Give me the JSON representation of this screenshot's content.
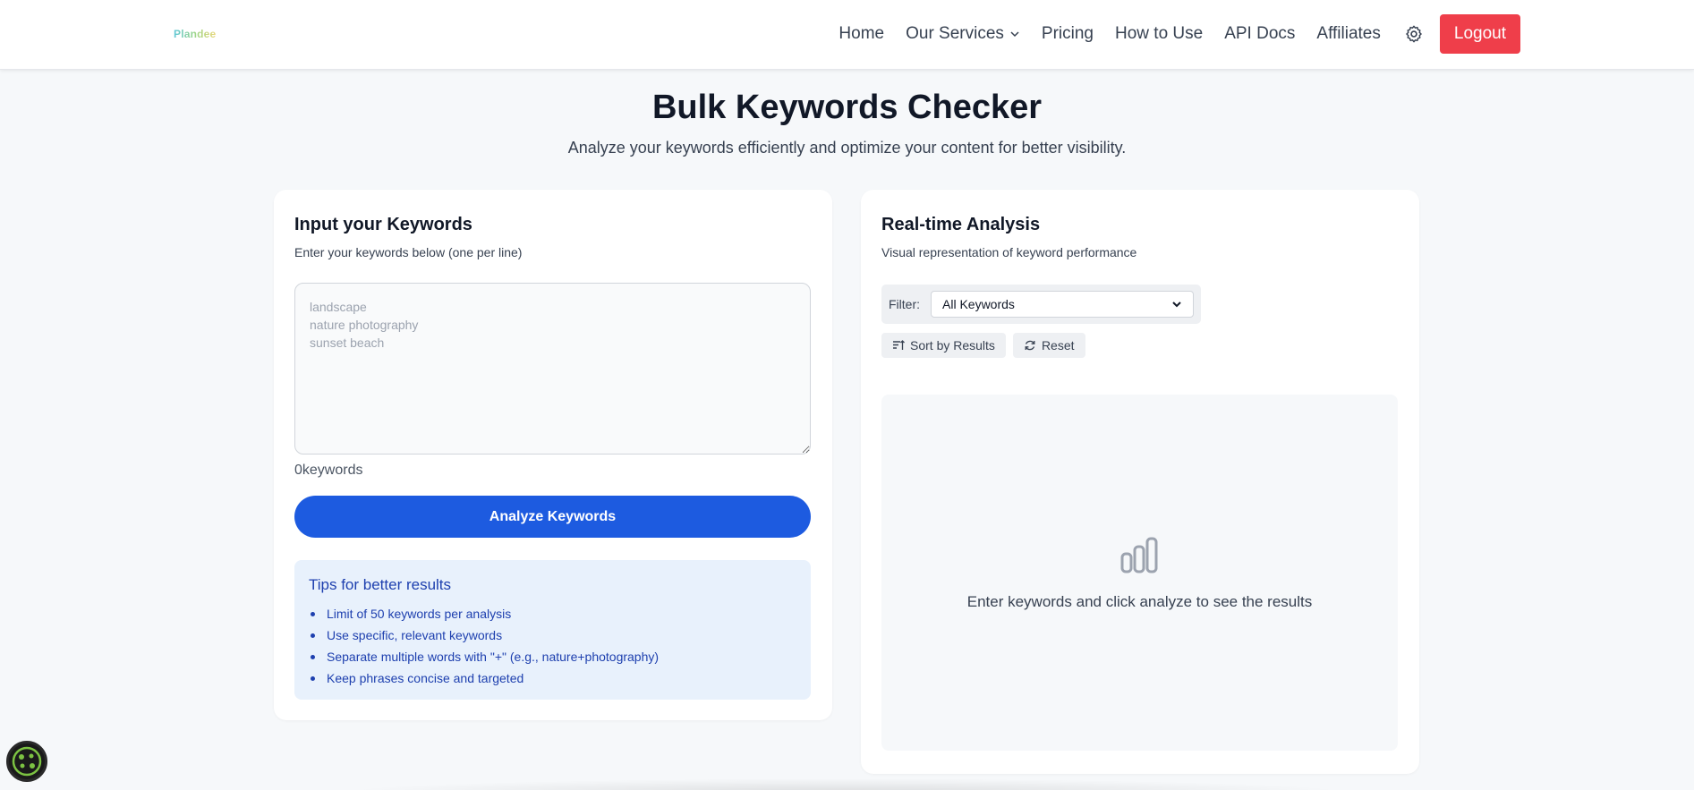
{
  "header": {
    "logo": "Plandee",
    "nav": {
      "home": "Home",
      "services": "Our Services",
      "pricing": "Pricing",
      "how_to_use": "How to Use",
      "api_docs": "API Docs",
      "affiliates": "Affiliates"
    },
    "logout": "Logout"
  },
  "page": {
    "title": "Bulk Keywords Checker",
    "subtitle": "Analyze your keywords efficiently and optimize your content for better visibility."
  },
  "input_card": {
    "title": "Input your Keywords",
    "description": "Enter your keywords below (one per line)",
    "placeholder": "landscape\nnature photography\nsunset beach",
    "keyword_count": "0keywords",
    "analyze_button": "Analyze Keywords",
    "tips": {
      "title": "Tips for better results",
      "items": [
        "Limit of 50 keywords per analysis",
        "Use specific, relevant keywords",
        "Separate multiple words with \"+\" (e.g., nature+photography)",
        "Keep phrases concise and targeted"
      ]
    }
  },
  "analysis_card": {
    "title": "Real-time Analysis",
    "description": "Visual representation of keyword performance",
    "filter_label": "Filter:",
    "filter_value": "All Keywords",
    "sort_button": "Sort by Results",
    "reset_button": "Reset",
    "empty_message": "Enter keywords and click analyze to see the results",
    "empty_icon": "bar-chart-icon"
  },
  "colors": {
    "primary": "#1d5be0",
    "logout": "#ef3e4a",
    "tips_bg": "#e8f1fc",
    "tips_text": "#1e40af"
  }
}
